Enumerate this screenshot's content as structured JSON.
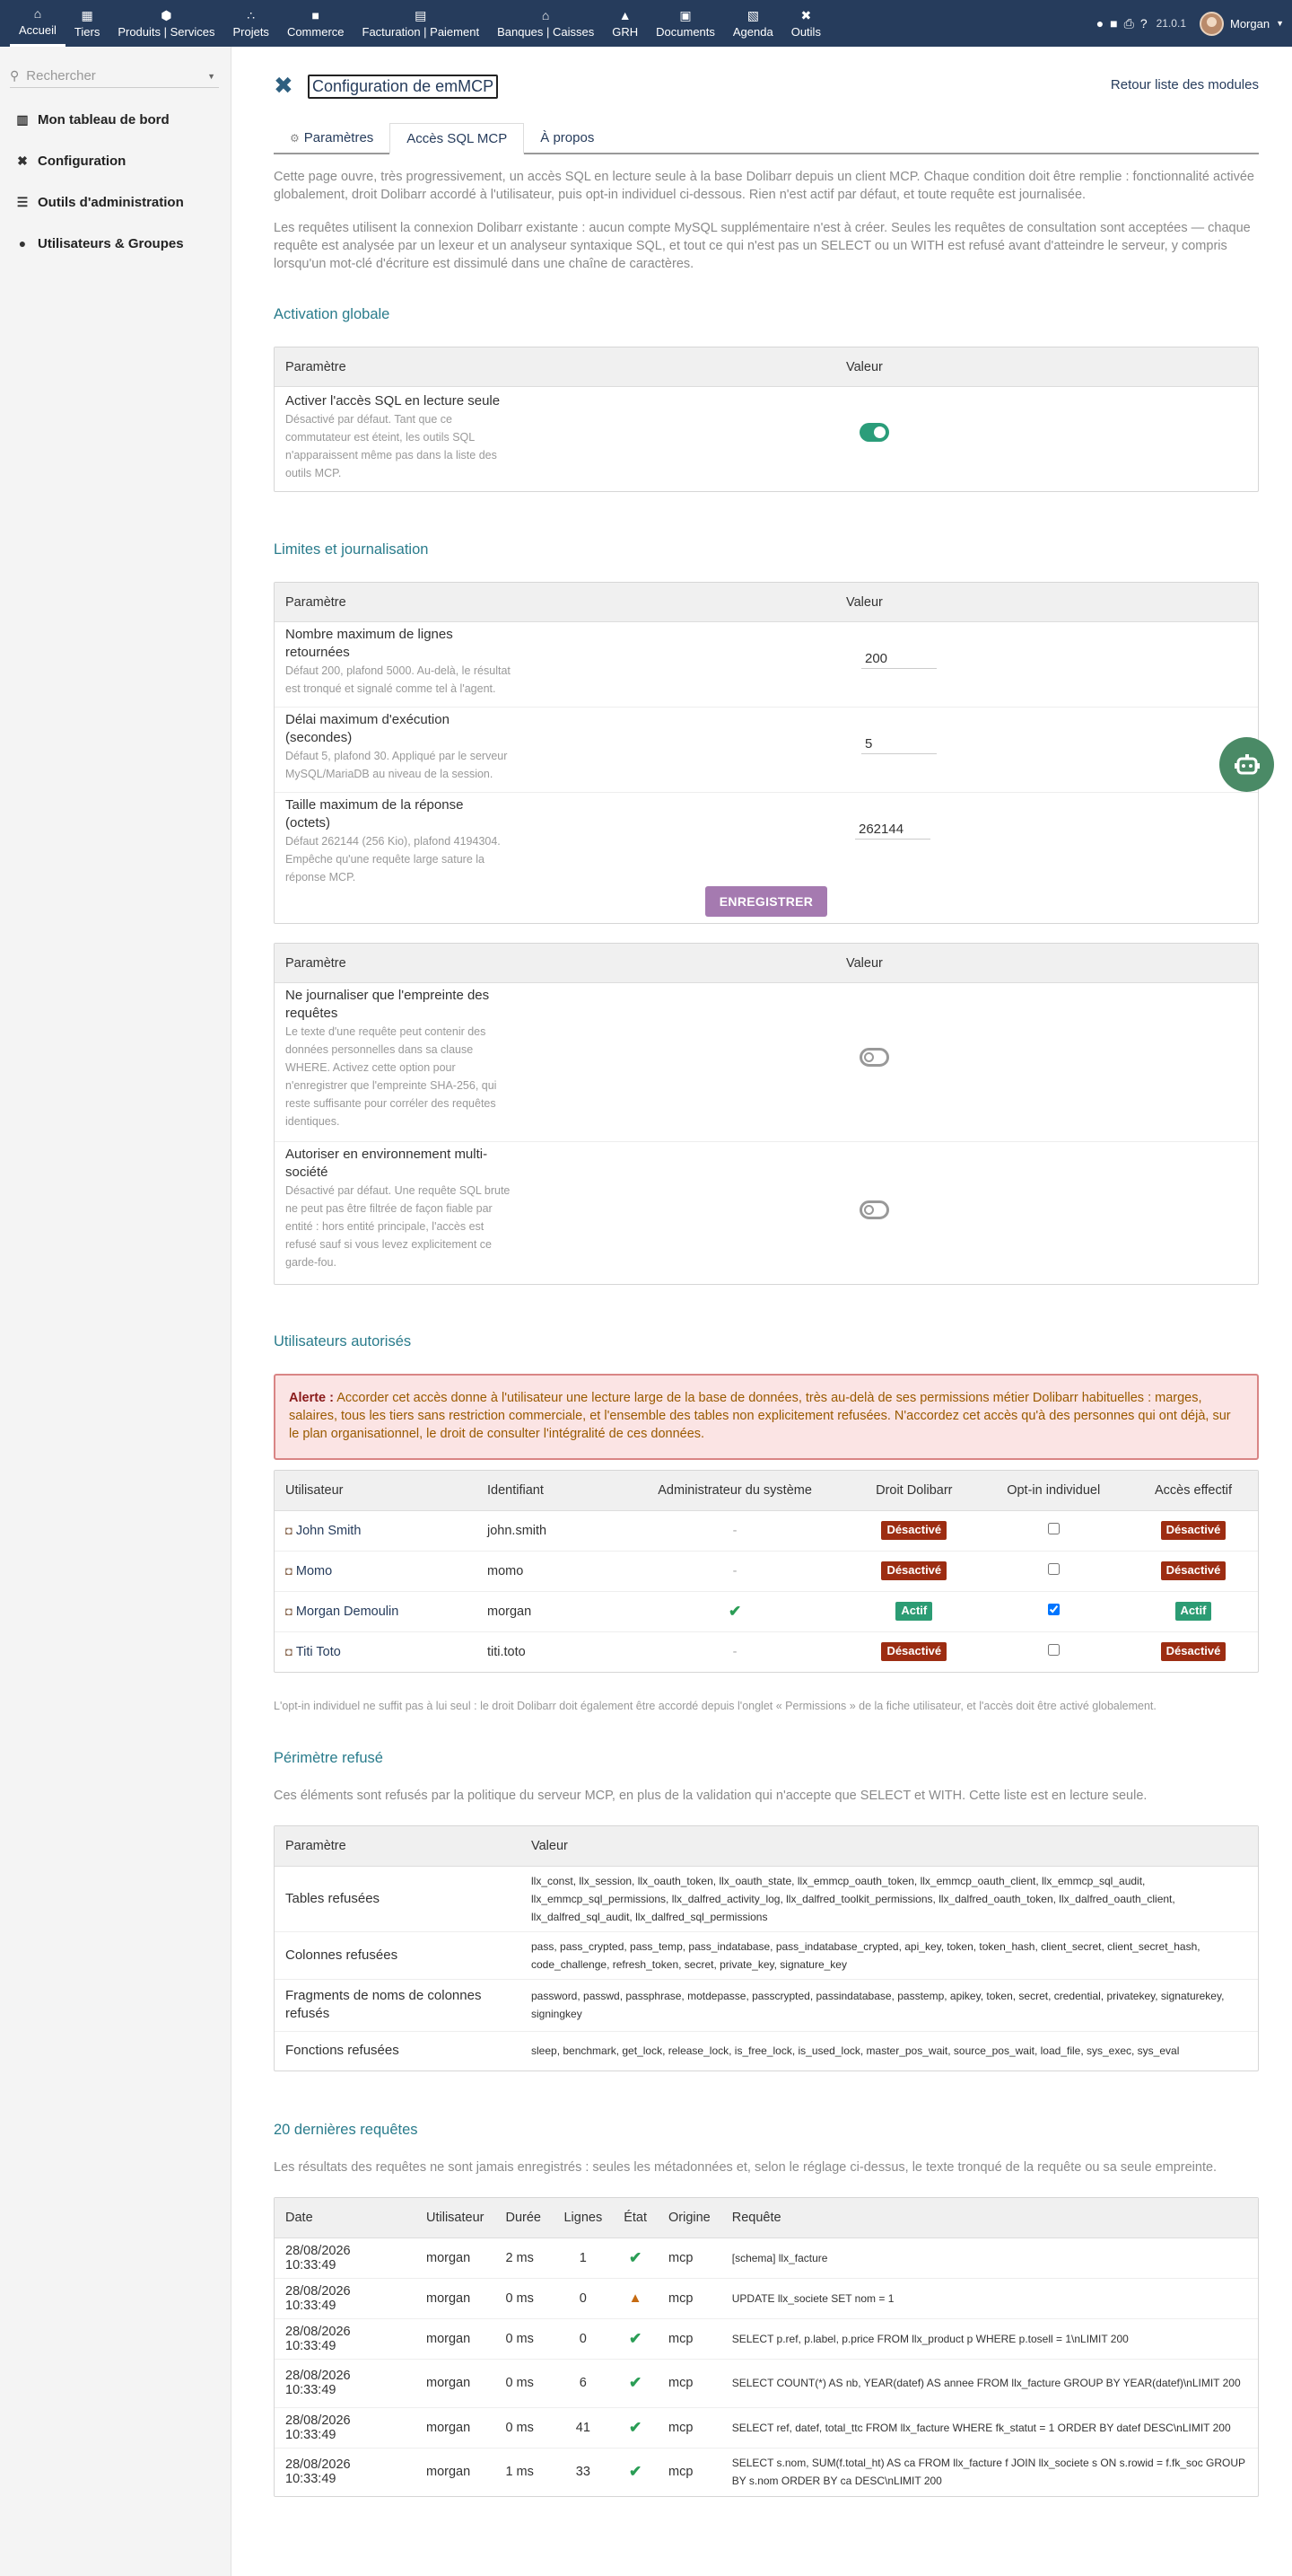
{
  "topnav": [
    {
      "label": "Accueil",
      "icon": "⌂",
      "name": "home"
    },
    {
      "label": "Tiers",
      "icon": "▦",
      "name": "thirdparties"
    },
    {
      "label": "Produits | Services",
      "icon": "⬢",
      "name": "products"
    },
    {
      "label": "Projets",
      "icon": "∴",
      "name": "projects"
    },
    {
      "label": "Commerce",
      "icon": "■",
      "name": "commerce"
    },
    {
      "label": "Facturation | Paiement",
      "icon": "▤",
      "name": "billing"
    },
    {
      "label": "Banques | Caisses",
      "icon": "⌂",
      "name": "banks"
    },
    {
      "label": "GRH",
      "icon": "▲",
      "name": "hrm"
    },
    {
      "label": "Documents",
      "icon": "▣",
      "name": "documents"
    },
    {
      "label": "Agenda",
      "icon": "▧",
      "name": "agenda"
    },
    {
      "label": "Outils",
      "icon": "✖",
      "name": "tools"
    }
  ],
  "topright": {
    "version": "21.0.1",
    "user": "Morgan"
  },
  "sidebar": {
    "search_placeholder": "Rechercher",
    "items": [
      {
        "label": "Mon tableau de bord",
        "icon": "▥",
        "name": "dashboard"
      },
      {
        "label": "Configuration",
        "icon": "✖",
        "name": "setup"
      },
      {
        "label": "Outils d'administration",
        "icon": "☰",
        "name": "admin-tools"
      },
      {
        "label": "Utilisateurs & Groupes",
        "icon": "●",
        "name": "users-groups"
      }
    ]
  },
  "page": {
    "title": "Configuration de emMCP",
    "back_label": "Retour liste des modules"
  },
  "tabs": [
    {
      "label": "Paramètres",
      "name": "params"
    },
    {
      "label": "Accès SQL MCP",
      "name": "sql-access"
    },
    {
      "label": "À propos",
      "name": "about"
    }
  ],
  "intro": {
    "p1": "Cette page ouvre, très progressivement, un accès SQL en lecture seule à la base Dolibarr depuis un client MCP. Chaque condition doit être remplie : fonctionnalité activée globalement, droit Dolibarr accordé à l'utilisateur, puis opt-in individuel ci-dessous. Rien n'est actif par défaut, et toute requête est journalisée.",
    "p2": "Les requêtes utilisent la connexion Dolibarr existante : aucun compte MySQL supplémentaire n'est à créer. Seules les requêtes de consultation sont acceptées — chaque requête est analysée par un lexeur et un analyseur syntaxique SQL, et tout ce qui n'est pas un SELECT ou un WITH est refusé avant d'atteindre le serveur, y compris lorsqu'un mot-clé d'écriture est dissimulé dans une chaîne de caractères."
  },
  "activation": {
    "section": "Activation globale",
    "col_param": "Paramètre",
    "col_value": "Valeur",
    "name": "Activer l'accès SQL en lecture seule",
    "desc": "Désactivé par défaut. Tant que ce commutateur est éteint, les outils SQL n'apparaissent même pas dans la liste des outils MCP."
  },
  "limits": {
    "section": "Limites et journalisation",
    "col_param": "Paramètre",
    "col_value": "Valeur",
    "rows": [
      {
        "name": "Nombre maximum de lignes retournées",
        "desc": "Défaut 200, plafond 5000. Au-delà, le résultat est tronqué et signalé comme tel à l'agent.",
        "value": "200"
      },
      {
        "name": "Délai maximum d'exécution (secondes)",
        "desc": "Défaut 5, plafond 30. Appliqué par le serveur MySQL/MariaDB au niveau de la session.",
        "value": "5"
      },
      {
        "name": "Taille maximum de la réponse (octets)",
        "desc": "Défaut 262144 (256 Kio), plafond 4194304. Empêche qu'une requête large sature la réponse MCP.",
        "value": "262144"
      }
    ],
    "save_label": "ENREGISTRER"
  },
  "logging": {
    "col_param": "Paramètre",
    "col_value": "Valeur",
    "rows": [
      {
        "name": "Ne journaliser que l'empreinte des requêtes",
        "desc": "Le texte d'une requête peut contenir des données personnelles dans sa clause WHERE. Activez cette option pour n'enregistrer que l'empreinte SHA-256, qui reste suffisante pour corréler des requêtes identiques."
      },
      {
        "name": "Autoriser en environnement multi-société",
        "desc": "Désactivé par défaut. Une requête SQL brute ne peut pas être filtrée de façon fiable par entité : hors entité principale, l'accès est refusé sauf si vous levez explicitement ce garde-fou."
      }
    ]
  },
  "authorized": {
    "section": "Utilisateurs autorisés",
    "alert_label": "Alerte :",
    "alert_text": "Accorder cet accès donne à l'utilisateur une lecture large de la base de données, très au-delà de ses permissions métier Dolibarr habituelles : marges, salaires, tous les tiers sans restriction commerciale, et l'ensemble des tables non explicitement refusées. N'accordez cet accès qu'à des personnes qui ont déjà, sur le plan organisationnel, le droit de consulter l'intégralité de ces données.",
    "columns": [
      "Utilisateur",
      "Identifiant",
      "Administrateur du système",
      "Droit Dolibarr",
      "Opt-in individuel",
      "Accès effectif"
    ],
    "users": [
      {
        "name": "John Smith",
        "login": "john.smith",
        "admin": "-",
        "right": "Désactivé",
        "optin": false,
        "effective": "Désactivé"
      },
      {
        "name": "Momo",
        "login": "momo",
        "admin": "-",
        "right": "Désactivé",
        "optin": false,
        "effective": "Désactivé"
      },
      {
        "name": "Morgan Demoulin",
        "login": "morgan",
        "admin": "✔",
        "right": "Actif",
        "optin": true,
        "effective": "Actif"
      },
      {
        "name": "Titi Toto",
        "login": "titi.toto",
        "admin": "-",
        "right": "Désactivé",
        "optin": false,
        "effective": "Désactivé"
      }
    ],
    "footnote": "L'opt-in individuel ne suffit pas à lui seul : le droit Dolibarr doit également être accordé depuis l'onglet « Permissions » de la fiche utilisateur, et l'accès doit être activé globalement."
  },
  "refused": {
    "section": "Périmètre refusé",
    "intro": "Ces éléments sont refusés par la politique du serveur MCP, en plus de la validation qui n'accepte que SELECT et WITH. Cette liste est en lecture seule.",
    "col_param": "Paramètre",
    "col_value": "Valeur",
    "rows": [
      {
        "name": "Tables refusées",
        "value": "llx_const, llx_session, llx_oauth_token, llx_oauth_state, llx_emmcp_oauth_token, llx_emmcp_oauth_client, llx_emmcp_sql_audit, llx_emmcp_sql_permissions, llx_dalfred_activity_log, llx_dalfred_toolkit_permissions, llx_dalfred_oauth_token, llx_dalfred_oauth_client, llx_dalfred_sql_audit, llx_dalfred_sql_permissions"
      },
      {
        "name": "Colonnes refusées",
        "value": "pass, pass_crypted, pass_temp, pass_indatabase, pass_indatabase_crypted, api_key, token, token_hash, client_secret, client_secret_hash, code_challenge, refresh_token, secret, private_key, signature_key"
      },
      {
        "name": "Fragments de noms de colonnes refusés",
        "value": "password, passwd, passphrase, motdepasse, passcrypted, passindatabase, passtemp, apikey, token, secret, credential, privatekey, signaturekey, signingkey"
      },
      {
        "name": "Fonctions refusées",
        "value": "sleep, benchmark, get_lock, release_lock, is_free_lock, is_used_lock, master_pos_wait, source_pos_wait, load_file, sys_exec, sys_eval"
      }
    ]
  },
  "logs": {
    "section": "20 dernières requêtes",
    "intro": "Les résultats des requêtes ne sont jamais enregistrés : seules les métadonnées et, selon le réglage ci-dessus, le texte tronqué de la requête ou sa seule empreinte.",
    "columns": [
      "Date",
      "Utilisateur",
      "Durée",
      "Lignes",
      "État",
      "Origine",
      "Requête"
    ],
    "rows": [
      {
        "date": "28/08/2026 10:33:49",
        "user": "morgan",
        "duration": "2 ms",
        "rows": "1",
        "state": "ok",
        "origin": "mcp",
        "query": "[schema] llx_facture"
      },
      {
        "date": "28/08/2026 10:33:49",
        "user": "morgan",
        "duration": "0 ms",
        "rows": "0",
        "state": "warn",
        "origin": "mcp",
        "query": "UPDATE llx_societe SET nom = 1"
      },
      {
        "date": "28/08/2026 10:33:49",
        "user": "morgan",
        "duration": "0 ms",
        "rows": "0",
        "state": "ok",
        "origin": "mcp",
        "query": "SELECT p.ref, p.label, p.price FROM llx_product p WHERE p.tosell = 1\\nLIMIT 200"
      },
      {
        "date": "28/08/2026 10:33:49",
        "user": "morgan",
        "duration": "0 ms",
        "rows": "6",
        "state": "ok",
        "origin": "mcp",
        "query": "SELECT COUNT(*) AS nb, YEAR(datef) AS annee FROM llx_facture GROUP BY YEAR(datef)\\nLIMIT 200"
      },
      {
        "date": "28/08/2026 10:33:49",
        "user": "morgan",
        "duration": "0 ms",
        "rows": "41",
        "state": "ok",
        "origin": "mcp",
        "query": "SELECT ref, datef, total_ttc FROM llx_facture WHERE fk_statut = 1 ORDER BY datef DESC\\nLIMIT 200"
      },
      {
        "date": "28/08/2026 10:33:49",
        "user": "morgan",
        "duration": "1 ms",
        "rows": "33",
        "state": "ok",
        "origin": "mcp",
        "query": "SELECT s.nom, SUM(f.total_ht) AS ca FROM llx_facture f JOIN llx_societe s ON s.rowid = f.fk_soc GROUP BY s.nom ORDER BY ca DESC\\nLIMIT 200"
      }
    ]
  },
  "colors": {
    "topbar": "#263c5c",
    "section": "#2a7c8c",
    "save": "#a57ab0",
    "active_badge": "#2c9c74",
    "off_badge": "#9d2d12"
  }
}
